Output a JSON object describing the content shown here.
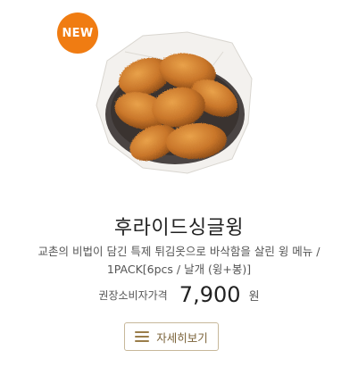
{
  "product": {
    "badge": "NEW",
    "image_icon": "fried-chicken-wings-photo",
    "title": "후라이드싱글윙",
    "description_line1": "교촌의 비법이 담긴 특제 튀김옷으로 바삭함을 살린 윙 메뉴 /",
    "description_line2": "1PACK[6pcs / 날개 (윙+봉)]",
    "price_label": "권장소비자가격",
    "price": "7,900",
    "price_unit": "원",
    "detail_button_label": "자세히보기",
    "detail_button_icon": "hamburger-menu-icon"
  },
  "colors": {
    "badge": "#f07c12",
    "button_border": "#c7b89a",
    "button_text": "#7a6238"
  }
}
